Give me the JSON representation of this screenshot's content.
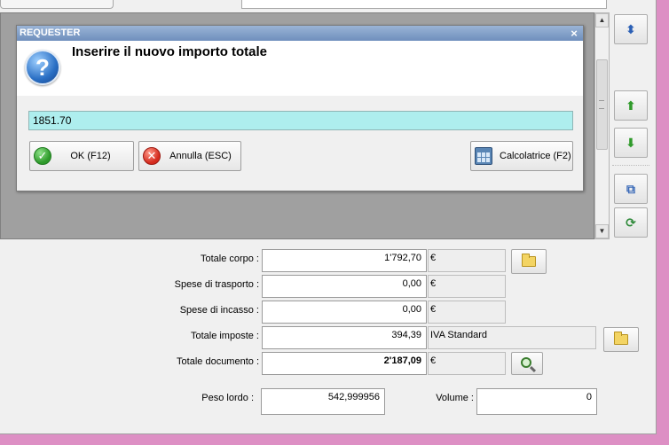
{
  "dialog": {
    "title": "REQUESTER",
    "close_glyph": "×",
    "question_glyph": "?",
    "question": "Inserire il nuovo importo totale",
    "value": "1851.70",
    "buttons": {
      "ok": "OK (F12)",
      "cancel": "Annulla (ESC)",
      "calculator": "Calcolatrice (F2)"
    }
  },
  "scrollbar": {
    "up": "▲",
    "down": "▼"
  },
  "side_toolbar": {
    "icons": [
      "sort-arrows-icon",
      "move-up-icon",
      "move-down-icon",
      "copy-icon",
      "refresh-icon"
    ],
    "glyphs": {
      "sort": "⬍",
      "up": "⬆",
      "down": "⬇",
      "copy": "⧉",
      "refresh": "⟳"
    }
  },
  "summary": {
    "totale_corpo": {
      "label": "Totale corpo :",
      "value": "1'792,70",
      "currency": "€"
    },
    "spese_trasporto": {
      "label": "Spese di trasporto :",
      "value": "0,00",
      "currency": "€"
    },
    "spese_incasso": {
      "label": "Spese di incasso :",
      "value": "0,00",
      "currency": "€"
    },
    "totale_imposte": {
      "label": "Totale imposte :",
      "value": "394,39",
      "vat": "IVA Standard"
    },
    "totale_documento": {
      "label": "Totale documento :",
      "value": "2'187,09",
      "currency": "€"
    },
    "peso_lordo": {
      "label": "Peso lordo :",
      "value": "542,999956"
    },
    "volume": {
      "label": "Volume :",
      "value": "0"
    }
  },
  "colors": {
    "input_highlight": "#aeeeee",
    "title_bar": "#7d9cc8",
    "desktop": "#dd8fc4",
    "grid_background": "#a0a0a0"
  }
}
